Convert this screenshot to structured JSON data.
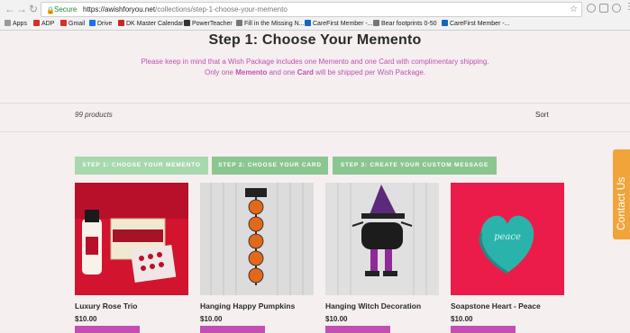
{
  "browser": {
    "secure_label": "Secure",
    "url_host": "https://awishforyou.net",
    "url_path": "/collections/step-1-choose-your-memento",
    "bookmarks": [
      "Apps",
      "ADP",
      "Gmail",
      "Drive",
      "DK Master Calendar",
      "PowerTeacher",
      "Fill in the Missing N...",
      "CareFirst Member -...",
      "Bear footprints 0-50",
      "CareFirst Member -..."
    ],
    "bookmark_colors": [
      "#c94b3c",
      "#d93025",
      "#d93025",
      "#1a73e8",
      "#c62828",
      "#333333",
      "#444444",
      "#1565c0",
      "#444444",
      "#1565c0"
    ]
  },
  "page": {
    "title": "Step 1: Choose Your Memento",
    "desc_line1": "Please keep in mind that a Wish Package includes one Memento and one Card with complimentary shipping.",
    "desc_line2_a": "Only one ",
    "desc_line2_b": "Memento",
    "desc_line2_c": " and one ",
    "desc_line2_d": "Card",
    "desc_line2_e": " will be shipped per Wish Package.",
    "product_count": "99 products",
    "sort_label": "Sort"
  },
  "steps": [
    {
      "label": "STEP 1: CHOOSE YOUR MEMENTO"
    },
    {
      "label": "STEP 2: CHOOSE YOUR CARD"
    },
    {
      "label": "STEP 3: CREATE YOUR CUSTOM MESSAGE"
    }
  ],
  "products": [
    {
      "name": "Luxury Rose Trio",
      "price": "$10.00"
    },
    {
      "name": "Hanging Happy Pumpkins",
      "price": "$10.00"
    },
    {
      "name": "Hanging Witch Decoration",
      "price": "$10.00"
    },
    {
      "name": "Soapstone Heart - Peace",
      "price": "$10.00",
      "heart_text": "peace"
    }
  ],
  "contact_tab": {
    "label": "Contact Us"
  },
  "colors": {
    "accent_pink": "#c34fb3",
    "step_green": "#8bc690",
    "step_green_light": "#a8d8ae",
    "contact_orange": "#f0a43a"
  }
}
